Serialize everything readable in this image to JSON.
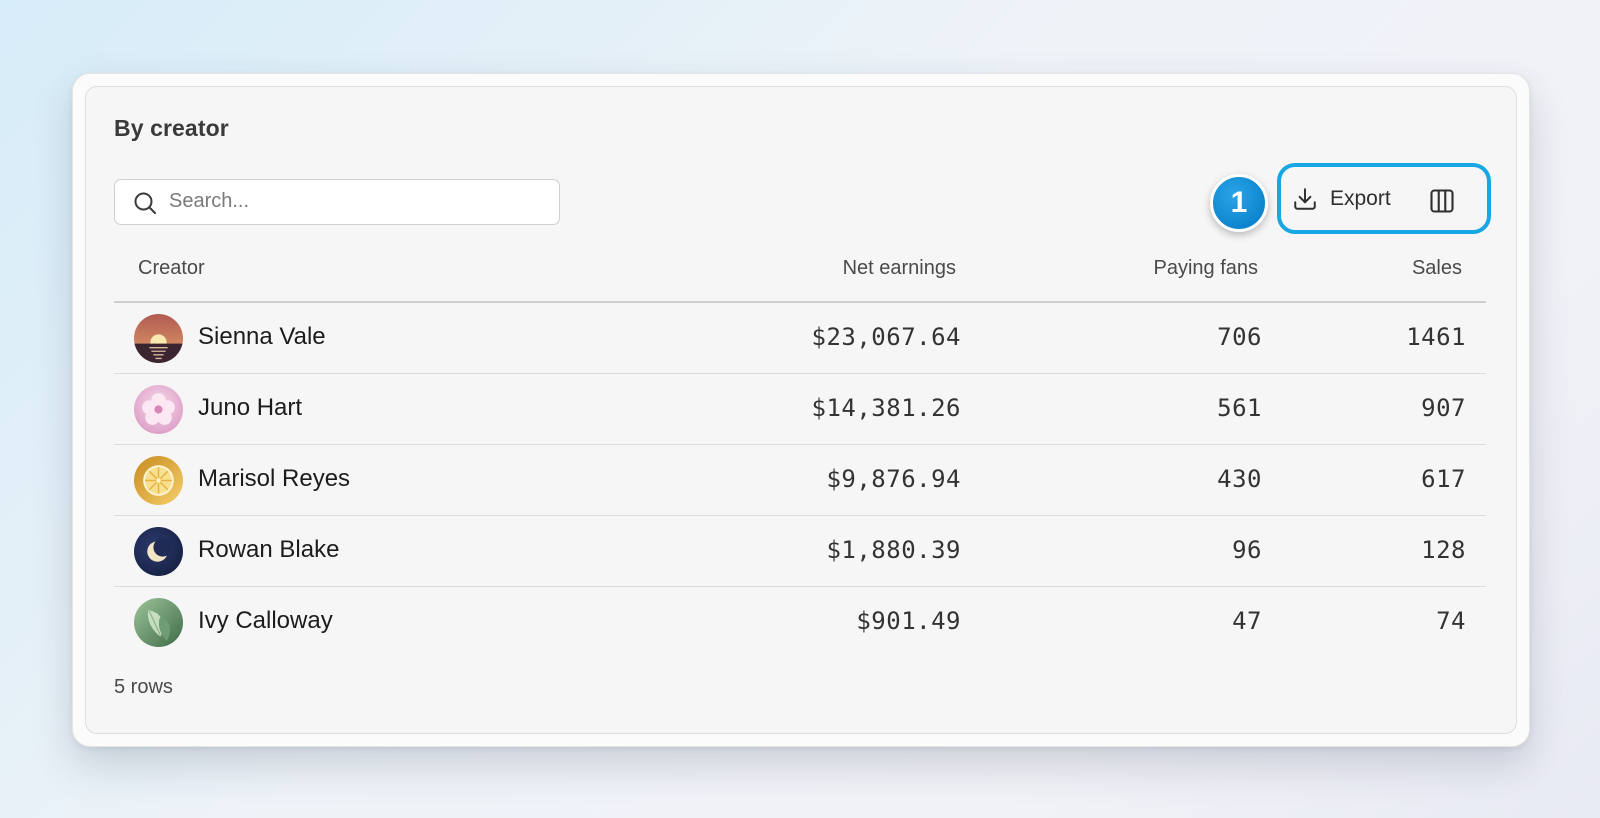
{
  "section": {
    "title": "By creator"
  },
  "search": {
    "placeholder": "Search...",
    "value": ""
  },
  "step_badge": "1",
  "toolbar": {
    "export_label": "Export",
    "highlight_color": "#17a8e3"
  },
  "table": {
    "columns": {
      "creator": "Creator",
      "net_earnings": "Net earnings",
      "paying_fans": "Paying fans",
      "sales": "Sales"
    },
    "rows": [
      {
        "name": "Sienna Vale",
        "net_earnings": "$23,067.64",
        "paying_fans": "706",
        "sales": "1461",
        "avatar": "sunset-avatar"
      },
      {
        "name": "Juno Hart",
        "net_earnings": "$14,381.26",
        "paying_fans": "561",
        "sales": "907",
        "avatar": "flower-avatar"
      },
      {
        "name": "Marisol Reyes",
        "net_earnings": "$9,876.94",
        "paying_fans": "430",
        "sales": "617",
        "avatar": "citrus-avatar"
      },
      {
        "name": "Rowan Blake",
        "net_earnings": "$1,880.39",
        "paying_fans": "96",
        "sales": "128",
        "avatar": "moon-avatar"
      },
      {
        "name": "Ivy Calloway",
        "net_earnings": "$901.49",
        "paying_fans": "47",
        "sales": "74",
        "avatar": "leaf-avatar"
      }
    ]
  },
  "footer": {
    "row_count": "5 rows"
  }
}
